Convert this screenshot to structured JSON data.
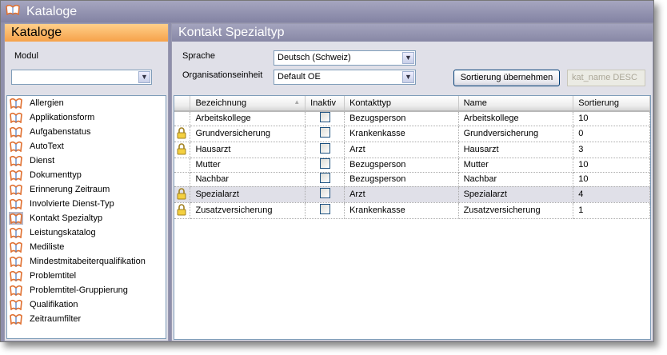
{
  "window": {
    "title": "Kataloge"
  },
  "left": {
    "header": "Kataloge",
    "modul_label": "Modul",
    "modul_value": "",
    "items": [
      "Allergien",
      "Applikationsform",
      "Aufgabenstatus",
      "AutoText",
      "Dienst",
      "Dokumenttyp",
      "Erinnerung Zeitraum",
      "Involvierte Dienst-Typ",
      "Kontakt Spezialtyp",
      "Leistungskatalog",
      "Mediliste",
      "Mindestmitabeiterqualifikation",
      "Problemtitel",
      "Problemtitel-Gruppierung",
      "Qualifikation",
      "Zeitraumfilter"
    ],
    "selected": "Kontakt Spezialtyp"
  },
  "right": {
    "header": "Kontakt Spezialtyp",
    "sprache_label": "Sprache",
    "sprache_value": "Deutsch (Schweiz)",
    "oe_label": "Organisationseinheit",
    "oe_value": "Default OE",
    "sort_button": "Sortierung übernehmen",
    "sort_field": "kat_name DESC"
  },
  "table": {
    "columns": [
      "Bezeichnung",
      "Inaktiv",
      "Kontakttyp",
      "Name",
      "Sortierung"
    ],
    "rows": [
      {
        "locked": false,
        "bez": "Arbeitskollege",
        "inaktiv": false,
        "typ": "Bezugsperson",
        "name": "Arbeitskollege",
        "sort": "10"
      },
      {
        "locked": true,
        "bez": "Grundversicherung",
        "inaktiv": false,
        "typ": "Krankenkasse",
        "name": "Grundversicherung",
        "sort": "0"
      },
      {
        "locked": true,
        "bez": "Hausarzt",
        "inaktiv": false,
        "typ": "Arzt",
        "name": "Hausarzt",
        "sort": "3"
      },
      {
        "locked": false,
        "bez": "Mutter",
        "inaktiv": false,
        "typ": "Bezugsperson",
        "name": "Mutter",
        "sort": "10"
      },
      {
        "locked": false,
        "bez": "Nachbar",
        "inaktiv": false,
        "typ": "Bezugsperson",
        "name": "Nachbar",
        "sort": "10"
      },
      {
        "locked": true,
        "bez": "Spezialarzt",
        "inaktiv": false,
        "typ": "Arzt",
        "name": "Spezialarzt",
        "sort": "4",
        "selected": true
      },
      {
        "locked": true,
        "bez": "Zusatzversicherung",
        "inaktiv": false,
        "typ": "Krankenkasse",
        "name": "Zusatzversicherung",
        "sort": "1"
      }
    ]
  }
}
